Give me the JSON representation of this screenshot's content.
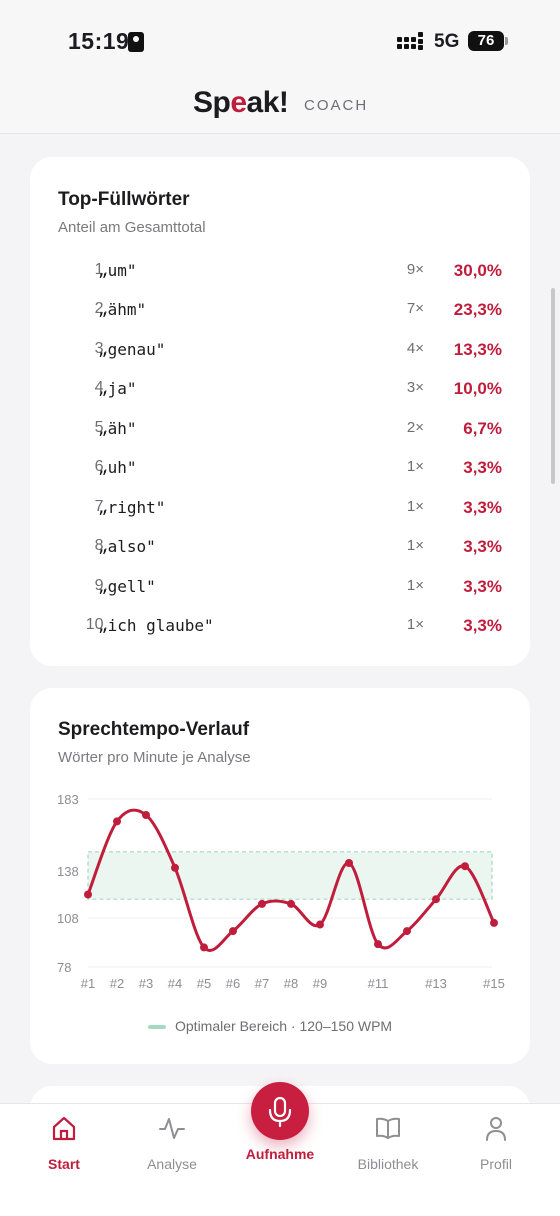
{
  "status": {
    "time": "15:19",
    "network": "5G",
    "battery": "76"
  },
  "header": {
    "logo_main": "Sp",
    "logo_accent": "e",
    "logo_rest": "ak!",
    "logo_sub": "COACH"
  },
  "filler": {
    "title": "Top-Füllwörter",
    "subtitle": "Anteil am Gesamttotal",
    "rows": [
      {
        "rank": "1.",
        "word": "„um\"",
        "count": "9×",
        "pct": "30,0%"
      },
      {
        "rank": "2.",
        "word": "„ähm\"",
        "count": "7×",
        "pct": "23,3%"
      },
      {
        "rank": "3.",
        "word": "„genau\"",
        "count": "4×",
        "pct": "13,3%"
      },
      {
        "rank": "4.",
        "word": "„ja\"",
        "count": "3×",
        "pct": "10,0%"
      },
      {
        "rank": "5.",
        "word": "„äh\"",
        "count": "2×",
        "pct": "6,7%"
      },
      {
        "rank": "6.",
        "word": "„uh\"",
        "count": "1×",
        "pct": "3,3%"
      },
      {
        "rank": "7.",
        "word": "„right\"",
        "count": "1×",
        "pct": "3,3%"
      },
      {
        "rank": "8.",
        "word": "„also\"",
        "count": "1×",
        "pct": "3,3%"
      },
      {
        "rank": "9.",
        "word": "„gell\"",
        "count": "1×",
        "pct": "3,3%"
      },
      {
        "rank": "10.",
        "word": "„ich glaube\"",
        "count": "1×",
        "pct": "3,3%"
      }
    ]
  },
  "tempo": {
    "title": "Sprechtempo-Verlauf",
    "subtitle": "Wörter pro Minute je Analyse",
    "legend": "Optimaler Bereich · 120–150 WPM"
  },
  "chart_data": {
    "type": "line",
    "x": [
      "#1",
      "#2",
      "#3",
      "#4",
      "#5",
      "#6",
      "#7",
      "#8",
      "#9",
      "#10",
      "#11",
      "#12",
      "#13",
      "#14",
      "#15"
    ],
    "x_tick_labels": [
      "#1",
      "#2",
      "#3",
      "#4",
      "#5",
      "#6",
      "#7",
      "#8",
      "#9",
      "",
      "#11",
      "",
      "#13",
      "",
      "#15"
    ],
    "values": [
      123,
      169,
      173,
      140,
      90,
      100,
      117,
      117,
      104,
      143,
      92,
      100,
      120,
      141,
      105
    ],
    "y_ticks": [
      "183",
      "138",
      "108",
      "78"
    ],
    "y_tick_values": [
      183,
      138,
      108,
      78
    ],
    "ylim": [
      78,
      183
    ],
    "optimal_band": [
      120,
      150
    ],
    "colors": {
      "line": "#c01d3c",
      "band_fill": "#eaf6ef",
      "band_stroke": "#a7d8c2"
    }
  },
  "tabs": [
    {
      "label": "Start",
      "icon": "home-icon",
      "active": true
    },
    {
      "label": "Analyse",
      "icon": "activity-icon",
      "active": false
    },
    {
      "label": "Aufnahme",
      "icon": "microphone-icon",
      "active": true
    },
    {
      "label": "Bibliothek",
      "icon": "book-icon",
      "active": false
    },
    {
      "label": "Profil",
      "icon": "user-icon",
      "active": false
    }
  ],
  "colors": {
    "accent": "#c01d3c",
    "background": "#f4f4f6"
  }
}
